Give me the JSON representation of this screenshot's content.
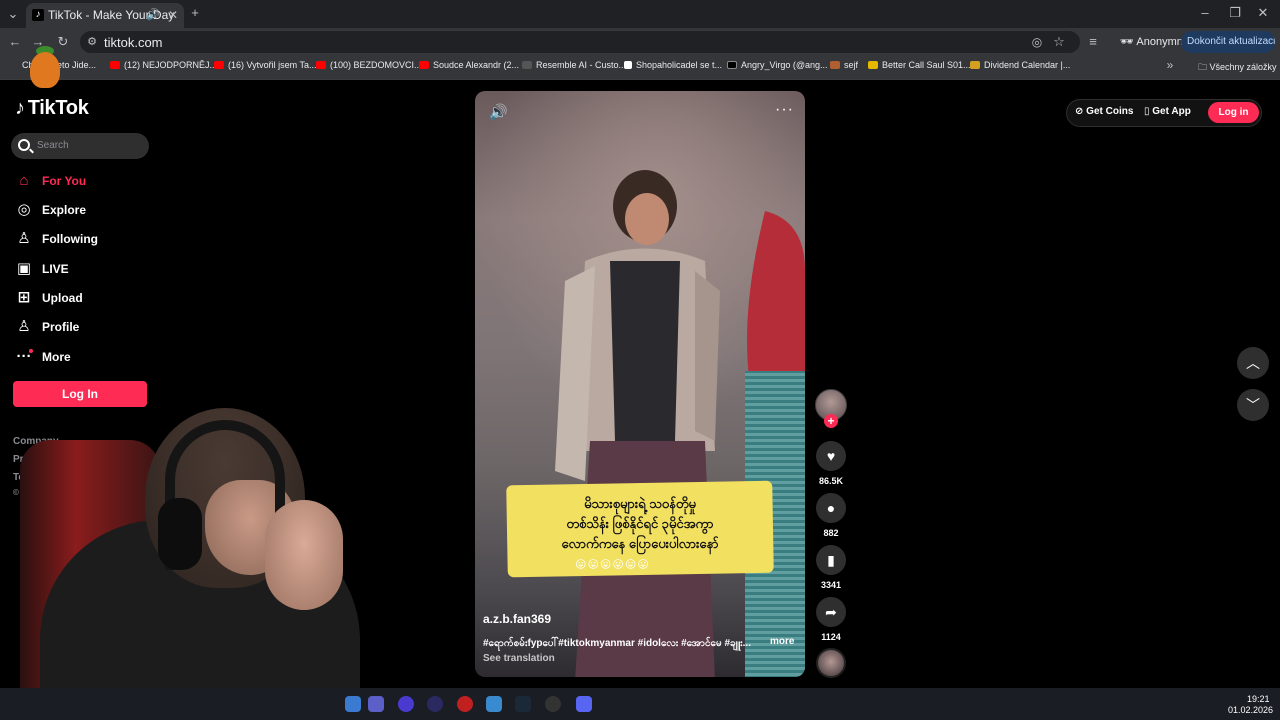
{
  "browser": {
    "tab_title": "TikTok - Make Your Day",
    "url": "tiktok.com",
    "profile_label": "Anonymní",
    "update_button": "Dokončit aktualizaci",
    "all_bookmarks": "Všechny záložky",
    "bookmarks": [
      "Chat... Keto Jide...",
      "(12) NEJODPORNĚJ...",
      "(16) Vytvořil jsem Ta...",
      "(100) BEZDOMOVCI...",
      "Soudce Alexandr (2...",
      "Resemble AI - Custo...",
      "Shopaholicadel se t...",
      "Angry_Virgo (@ang...",
      "sejf",
      "Better Call Saul S01...",
      "Dividend Calendar |..."
    ]
  },
  "sidebar": {
    "logo": "TikTok",
    "search_placeholder": "Search",
    "nav": [
      {
        "label": "For You",
        "icon": "home-icon"
      },
      {
        "label": "Explore",
        "icon": "compass-icon"
      },
      {
        "label": "Following",
        "icon": "following-icon"
      },
      {
        "label": "LIVE",
        "icon": "live-icon"
      },
      {
        "label": "Upload",
        "icon": "upload-icon"
      },
      {
        "label": "Profile",
        "icon": "profile-icon"
      },
      {
        "label": "More",
        "icon": "more-icon"
      }
    ],
    "login_button": "Log In",
    "footer": [
      "Company",
      "Program",
      "Terms",
      "© 202"
    ]
  },
  "topbar": {
    "get_coins": "Get Coins",
    "get_app": "Get App",
    "login": "Log in"
  },
  "video": {
    "caption_lines": [
      "မိသားစုများရဲ့ သဝန်တိုမှု",
      "တစ်သိန်း ဖြစ်နိုင်ရင် ၃မိုင်အကွာ",
      "လောက်ကနေ ပြောပေးပါလားနော်"
    ],
    "emojis": "😛😛😛😛😛😛",
    "author": "a.z.b.fan369",
    "description": "#ရောက်စမ်းfypပေါ်#tiktokmyanmar #idolလေး #အောင်မေ #ချူး...",
    "more": "more",
    "see_translation": "See translation"
  },
  "actions": {
    "likes": "86.5K",
    "comments": "882",
    "saves": "3341",
    "shares": "1124"
  },
  "taskbar": {
    "time": "19:21",
    "date": "01.02.2026"
  },
  "colors": {
    "accent": "#fe2c55",
    "background": "#000000",
    "chrome": "#35363a"
  }
}
